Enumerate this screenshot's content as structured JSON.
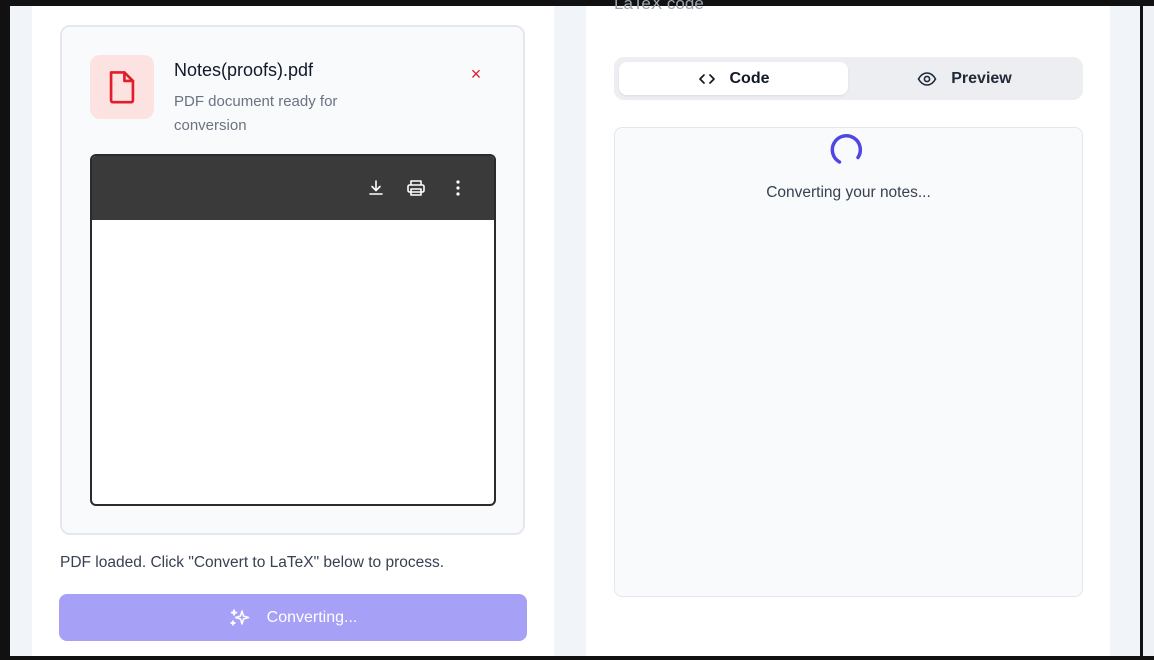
{
  "file": {
    "name": "Notes(proofs).pdf",
    "subtitle": "PDF document ready for conversion",
    "close_glyph": "×",
    "icon": "file-icon",
    "icon_color": "#e11d2a"
  },
  "viewer": {
    "toolbar_icons": [
      "download-icon",
      "print-icon",
      "more-vertical-icon"
    ]
  },
  "status": {
    "message": "PDF loaded. Click \"Convert to LaTeX\" below to process."
  },
  "convert_button": {
    "label": "Converting...",
    "icon": "sparkles-icon",
    "color": "#a6a0f7"
  },
  "right": {
    "heading": "LaTeX code",
    "tabs": [
      {
        "label": "Code",
        "icon": "code-icon",
        "active": true
      },
      {
        "label": "Preview",
        "icon": "eye-icon",
        "active": false
      }
    ],
    "loading_text": "Converting your notes...",
    "spinner_color": "#4f46e5"
  }
}
